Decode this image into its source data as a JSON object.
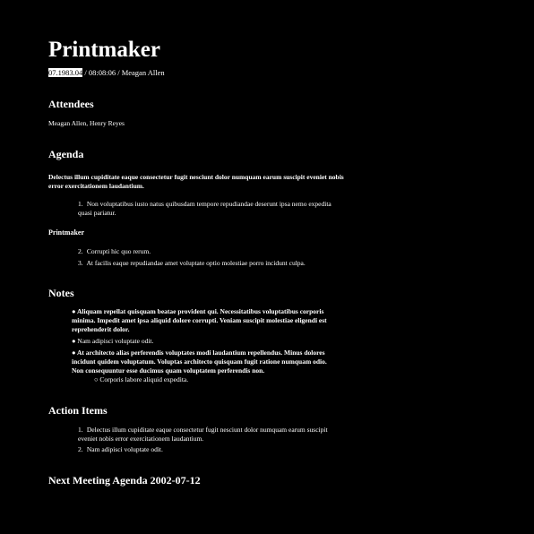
{
  "title": "Printmaker",
  "meta": {
    "date": "07.1983.04",
    "rest": " / 08:08:06 / Meagan Allen"
  },
  "attendees": {
    "heading": "Attendees",
    "names": "Meagan Allen, Henry Reyes"
  },
  "agenda": {
    "heading": "Agenda",
    "intro": "Delectus illum cupiditate eaque consectetur fugit nesciunt dolor numquam earum suscipit eveniet nobis error exercitationem laudantium.",
    "items_a": [
      {
        "num": "1.",
        "text": "Non voluptatibus iusto natus quibusdam tempore repudiandae deserunt ipsa nemo expedita quasi pariatur."
      }
    ],
    "subheading": "Printmaker",
    "items_b": [
      {
        "num": "2.",
        "text": "Corrupti hic quo rerum."
      },
      {
        "num": "3.",
        "text": "At facilis eaque repudiandae amet voluptate optio molestiae porro incidunt culpa."
      }
    ]
  },
  "notes": {
    "heading": "Notes",
    "items": [
      {
        "bullet": "●",
        "text": "Aliquam repellat quisquam beatae provident qui. Necessitatibus voluptatibus corporis minima. Impedit amet ipsa aliquid dolore corrupti. Veniam suscipit molestiae eligendi est reprehenderit dolor."
      },
      {
        "bullet": "●",
        "text": "Nam adipisci voluptate odit."
      },
      {
        "bullet": "●",
        "text": "At architecto alias perferendis voluptates modi laudantium repellendus. Minus dolores incidunt quidem voluptatum. Voluptas architecto quisquam fugit ratione numquam odio. Non consequuntur esse ducimus quam voluptatem perferendis non."
      }
    ],
    "subitem": {
      "bullet": "○",
      "text": "Corporis labore aliquid expedita."
    }
  },
  "action_items": {
    "heading": "Action Items",
    "items": [
      {
        "num": "1.",
        "text": "Delectus illum cupiditate eaque consectetur fugit nesciunt dolor numquam earum suscipit eveniet nobis error exercitationem laudantium."
      },
      {
        "num": "2.",
        "text": "Nam adipisci voluptate odit."
      }
    ]
  },
  "next_meeting": {
    "heading": "Next Meeting Agenda 2002-07-12"
  }
}
